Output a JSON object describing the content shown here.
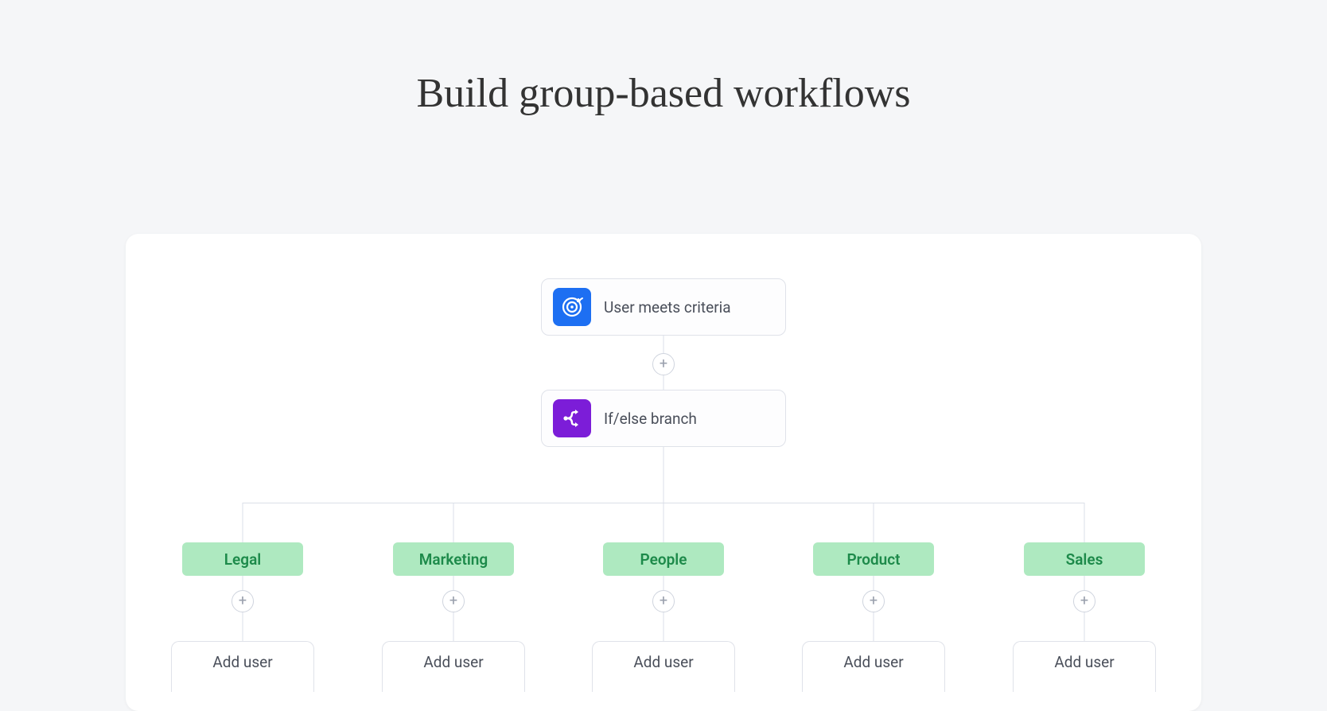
{
  "title": "Build group-based workflows",
  "workflow": {
    "trigger": {
      "label": "User meets criteria"
    },
    "condition": {
      "label": "If/else branch"
    },
    "branches": [
      {
        "name": "Legal",
        "action_label": "Add user"
      },
      {
        "name": "Marketing",
        "action_label": "Add user"
      },
      {
        "name": "People",
        "action_label": "Add user"
      },
      {
        "name": "Product",
        "action_label": "Add user"
      },
      {
        "name": "Sales",
        "action_label": "Add user"
      }
    ]
  }
}
